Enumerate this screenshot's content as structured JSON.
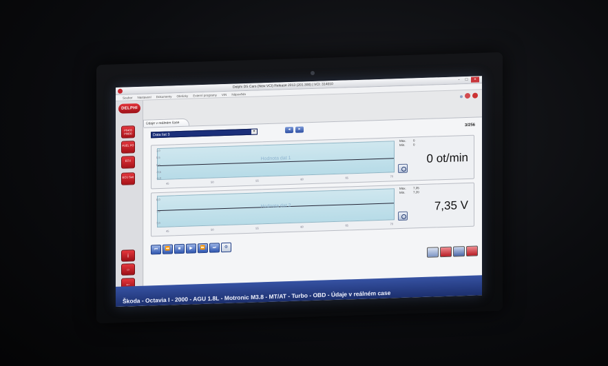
{
  "window": {
    "title": "Delphi DS Cars (New VCI) Release 2013 (201.300) | VCI: 314010",
    "controls": [
      "-",
      "□",
      "×"
    ]
  },
  "menu": [
    "Soubor",
    "Nastavení",
    "Dokumenty",
    "Obrázky",
    "Externí programy",
    "VIN",
    "Nápověda"
  ],
  "branding": {
    "logo": "DELPHI"
  },
  "sidebar": {
    "buttons": [
      "P0403 P0600",
      "FUEL PO",
      "ECU",
      "ECU Sett"
    ],
    "lower_icons": [
      "info-icon",
      "vehicle-icon",
      "back-arrow-icon"
    ]
  },
  "tab": {
    "label": "Údaje v reálném čase"
  },
  "toolbar": {
    "data_list": "Data list 3",
    "page": "3/256"
  },
  "panels": [
    {
      "caption": "Hodnota dat 1",
      "y_ticks": [
        "1,0",
        "0,5",
        "0,0",
        "-0,5",
        "-1,0"
      ],
      "x_ticks": [
        "45",
        "50",
        "55",
        "60",
        "65",
        "70"
      ],
      "max_label": "Max.",
      "min_label": "Min.",
      "max_value": "0",
      "min_value": "0",
      "value": "0 ot/min"
    },
    {
      "caption": "Hodnota dat 2",
      "y_ticks": [
        "8,0",
        "7,5",
        "7,0"
      ],
      "x_ticks": [
        "45",
        "50",
        "55",
        "60",
        "65",
        "70"
      ],
      "max_label": "Max.",
      "min_label": "Min.",
      "max_value": "7,35",
      "min_value": "7,20",
      "value": "7,35 V"
    }
  ],
  "transport": [
    "⏮",
    "⏪",
    "■",
    "▶",
    "⏩",
    "⏭",
    "⚙"
  ],
  "status": "Škoda - Octavia I - 2000 - AGU 1.8L - Motronic M3.8 - MT/AT - Turbo - OBD - Údaje v reálném case",
  "colors": {
    "accent_red": "#c4262e",
    "status_blue": "#1c2f6d",
    "select_blue": "#1b2f7a",
    "graph_bg": "#b7dbe7"
  }
}
